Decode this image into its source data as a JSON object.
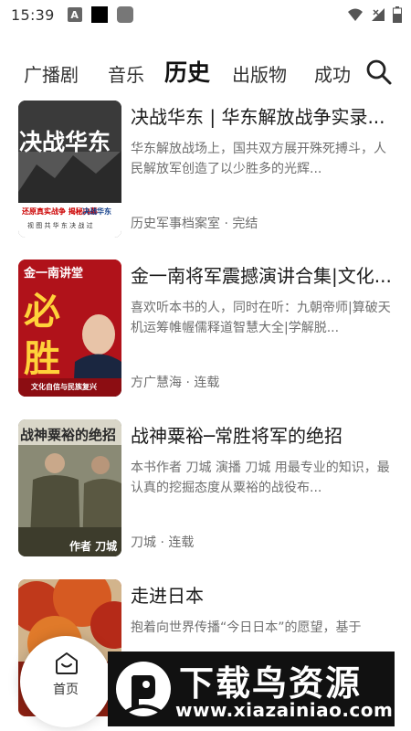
{
  "status_bar": {
    "time": "15:39",
    "icons": [
      "notification-a-icon",
      "black-square-icon",
      "gray-square-icon",
      "wifi-icon",
      "signal-icon",
      "battery-icon"
    ]
  },
  "tabs": [
    {
      "label": "广播剧",
      "active": false
    },
    {
      "label": "音乐",
      "active": false
    },
    {
      "label": "历史",
      "active": true
    },
    {
      "label": "出版物",
      "active": false
    },
    {
      "label": "成功",
      "active": false
    }
  ],
  "search": {
    "icon": "search-icon"
  },
  "books": [
    {
      "title": "决战华东 | 华东解放战争实录...",
      "description": "华东解放战场上，国共双方展开殊死搏斗，人民解放军创造了以少胜多的光辉...",
      "meta": "历史军事档案室 · 完结",
      "cover_text": [
        "决战华东",
        "还原真实战争 揭秘内幕",
        "决战华东",
        "视 图 共 华 东 决 战 过"
      ]
    },
    {
      "title": "金一南将军震撼演讲合集|文化...",
      "description": "喜欢听本书的人，同时在听：九朝帝师|算破天机运筹帷幄儒释道智慧大全|学解脱...",
      "meta": "方广慧海 · 连载",
      "cover_text": [
        "金一南讲堂",
        "必",
        "胜",
        "文化自信与民族复兴"
      ]
    },
    {
      "title": "战神粟裕─常胜将军的绝招",
      "description": "本书作者 刀城 演播 刀城 用最专业的知识，最认真的挖掘态度从粟裕的战役布...",
      "meta": "刀城 · 连载",
      "cover_text": [
        "战神粟裕的绝招",
        "作者 刀城"
      ]
    },
    {
      "title": "走进日本",
      "description": "抱着向世界传播“今日日本”的愿望，基于",
      "meta": "",
      "cover_text": []
    }
  ],
  "bottom_nav": {
    "home_label": "首页",
    "icon": "home-icon"
  },
  "watermark": {
    "title": "下载鸟资源",
    "url": "www.xiazainiao.com"
  },
  "colors": {
    "accent": "#111111",
    "text_secondary": "#6f6f6f",
    "cover2_red": "#b0121a"
  }
}
